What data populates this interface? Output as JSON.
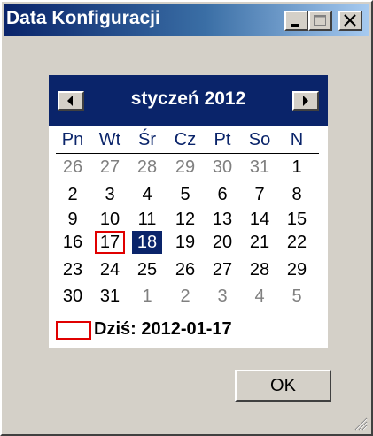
{
  "window": {
    "title": "Data Konfiguracji",
    "minimize_icon": "minimize-icon",
    "maximize_icon": "maximize-icon",
    "close_icon": "close-icon"
  },
  "calendar": {
    "month_label": "styczeń 2012",
    "prev_icon": "left-arrow-icon",
    "next_icon": "right-arrow-icon",
    "weekdays": [
      "Pn",
      "Wt",
      "Śr",
      "Cz",
      "Pt",
      "So",
      "N"
    ],
    "weeks": [
      [
        "26",
        "27",
        "28",
        "29",
        "30",
        "31",
        "1"
      ],
      [
        "2",
        "3",
        "4",
        "5",
        "6",
        "7",
        "8"
      ],
      [
        "9",
        "10",
        "11",
        "12",
        "13",
        "14",
        "15"
      ],
      [
        "16",
        "17",
        "18",
        "19",
        "20",
        "21",
        "22"
      ],
      [
        "23",
        "24",
        "25",
        "26",
        "27",
        "28",
        "29"
      ],
      [
        "30",
        "31",
        "1",
        "2",
        "3",
        "4",
        "5"
      ]
    ],
    "selected_day": "18",
    "today_day": "17",
    "today_label": "Dziś: 2012-01-17",
    "header_color": "#0a246a",
    "weekday_color": "#0a246a",
    "today_marker_color": "#e00000",
    "other_month_color": "#808080"
  },
  "buttons": {
    "ok_label": "OK"
  }
}
